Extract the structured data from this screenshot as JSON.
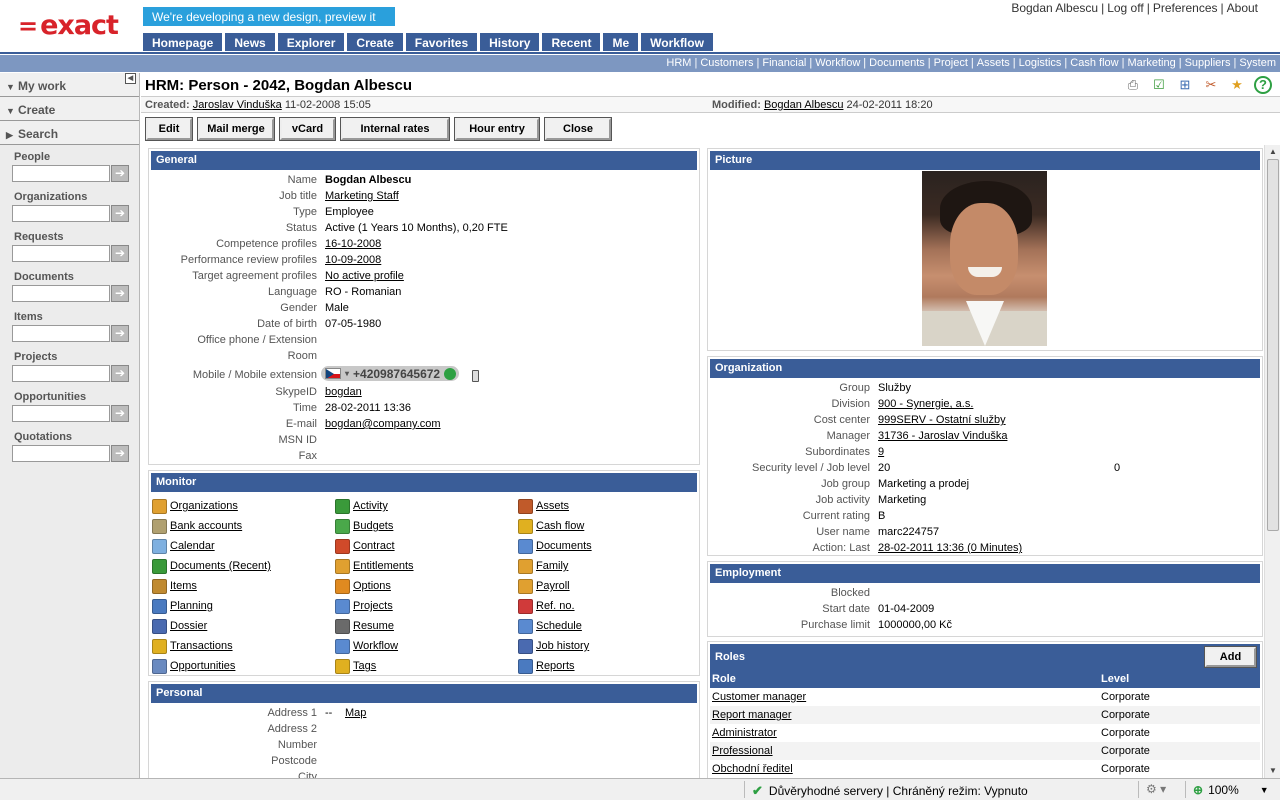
{
  "header": {
    "logo": "exact",
    "preview_banner": "We're developing a new design, preview it here!",
    "nav": [
      "Homepage",
      "News",
      "Explorer",
      "Create",
      "Favorites",
      "History",
      "Recent",
      "Me",
      "Workflow"
    ],
    "user_links": [
      "Bogdan Albescu",
      "Log off",
      "Preferences",
      "About"
    ]
  },
  "module_links": [
    "HRM",
    "Customers",
    "Financial",
    "Workflow",
    "Documents",
    "Project",
    "Assets",
    "Logistics",
    "Cash flow",
    "Marketing",
    "Suppliers",
    "System"
  ],
  "sidebar": {
    "heads": [
      "My work",
      "Create",
      "Search"
    ],
    "sections": [
      "People",
      "Organizations",
      "Requests",
      "Documents",
      "Items",
      "Projects",
      "Opportunities",
      "Quotations"
    ],
    "go_glyph": "➔"
  },
  "page": {
    "title": "HRM: Person - 2042, Bogdan Albescu",
    "created_label": "Created:",
    "created_by": "Jaroslav Vinduška",
    "created_at": "11-02-2008 15:05",
    "modified_label": "Modified:",
    "modified_by": "Bogdan Albescu",
    "modified_at": "24-02-2011 18:20"
  },
  "buttons": [
    "Edit",
    "Mail merge",
    "vCard",
    "Internal rates",
    "Hour entry",
    "Close"
  ],
  "toolbar_icons": [
    "print-icon",
    "checklist-icon",
    "add-window-icon",
    "tools-icon",
    "favorite-star-icon",
    "help-icon"
  ],
  "general": {
    "title": "General",
    "fields": [
      {
        "label": "Name",
        "value": "Bogdan Albescu",
        "bold": true
      },
      {
        "label": "Job title",
        "value": "Marketing Staff",
        "link": true
      },
      {
        "label": "Type",
        "value": "Employee"
      },
      {
        "label": "Status",
        "value": "Active (1 Years 10 Months), 0,20 FTE"
      },
      {
        "label": "Competence profiles",
        "value": "16-10-2008",
        "link": true
      },
      {
        "label": "Performance review profiles",
        "value": "10-09-2008",
        "link": true
      },
      {
        "label": "Target agreement profiles",
        "value": "No active profile",
        "link": true
      },
      {
        "label": "Language",
        "value": "RO - Romanian"
      },
      {
        "label": "Gender",
        "value": "Male"
      },
      {
        "label": "Date of birth",
        "value": "07-05-1980"
      },
      {
        "label": "Office phone / Extension",
        "value": ""
      },
      {
        "label": "Room",
        "value": ""
      }
    ],
    "mobile_label": "Mobile / Mobile extension",
    "mobile_number": "+420987645672",
    "fields2": [
      {
        "label": "SkypeID",
        "value": "bogdan",
        "link": true
      },
      {
        "label": "Time",
        "value": "28-02-2011 13:36"
      },
      {
        "label": "E-mail",
        "value": "bogdan@company.com",
        "link": true
      },
      {
        "label": "MSN ID",
        "value": ""
      },
      {
        "label": "Fax",
        "value": ""
      }
    ]
  },
  "monitor": {
    "title": "Monitor",
    "items": [
      {
        "label": "Organizations",
        "color": "#e0a030"
      },
      {
        "label": "Activity",
        "color": "#3a9a3a"
      },
      {
        "label": "Assets",
        "color": "#c05a2a"
      },
      {
        "label": "Bank accounts",
        "color": "#b0a070"
      },
      {
        "label": "Budgets",
        "color": "#4aa84a"
      },
      {
        "label": "Cash flow",
        "color": "#e0b020"
      },
      {
        "label": "Calendar",
        "color": "#7fb0e0"
      },
      {
        "label": "Contract",
        "color": "#d04a2a"
      },
      {
        "label": "Documents",
        "color": "#5a8ad0"
      },
      {
        "label": "Documents (Recent)",
        "color": "#3a9a3a"
      },
      {
        "label": "Entitlements",
        "color": "#e0a030"
      },
      {
        "label": "Family",
        "color": "#e0a030"
      },
      {
        "label": "Items",
        "color": "#c08a30"
      },
      {
        "label": "Options",
        "color": "#e08a20"
      },
      {
        "label": "Payroll",
        "color": "#e0a030"
      },
      {
        "label": "Planning",
        "color": "#4a7ac0"
      },
      {
        "label": "Projects",
        "color": "#5a8ad0"
      },
      {
        "label": "Ref. no.",
        "color": "#d03a3a"
      },
      {
        "label": "Dossier",
        "color": "#4a6ab0"
      },
      {
        "label": "Resume",
        "color": "#6a6a6a"
      },
      {
        "label": "Schedule",
        "color": "#5a8ad0"
      },
      {
        "label": "Transactions",
        "color": "#e0b020"
      },
      {
        "label": "Workflow",
        "color": "#5a8ad0"
      },
      {
        "label": "Job history",
        "color": "#4a6ab0"
      },
      {
        "label": "Opportunities",
        "color": "#6a8ac0"
      },
      {
        "label": "Tags",
        "color": "#e0b020"
      },
      {
        "label": "Reports",
        "color": "#4a7ac0"
      }
    ]
  },
  "personal": {
    "title": "Personal",
    "fields": [
      {
        "label": "Address 1",
        "value": "--",
        "extra": "Map"
      },
      {
        "label": "Address 2",
        "value": ""
      },
      {
        "label": "Number",
        "value": ""
      },
      {
        "label": "Postcode",
        "value": ""
      },
      {
        "label": "City",
        "value": ""
      }
    ]
  },
  "picture": {
    "title": "Picture"
  },
  "organization": {
    "title": "Organization",
    "fields": [
      {
        "label": "Group",
        "value": "Služby"
      },
      {
        "label": "Division",
        "value": "900 - Synergie, a.s.",
        "link": true
      },
      {
        "label": "Cost center",
        "value": "999SERV - Ostatní služby",
        "link": true
      },
      {
        "label": "Manager",
        "value": "31736 - Jaroslav Vinduška",
        "link": true
      },
      {
        "label": "Subordinates",
        "value": "9",
        "link": true
      },
      {
        "label": "Security level / Job level",
        "value": "20",
        "value2": "0"
      },
      {
        "label": "Job group",
        "value": "Marketing a prodej"
      },
      {
        "label": "Job activity",
        "value": "Marketing"
      },
      {
        "label": "Current rating",
        "value": "B"
      },
      {
        "label": "User name",
        "value": "marc224757"
      },
      {
        "label": "Action: Last",
        "value": "28-02-2011 13:36 (0 Minutes)",
        "link": true
      }
    ]
  },
  "employment": {
    "title": "Employment",
    "fields": [
      {
        "label": "Blocked",
        "value": ""
      },
      {
        "label": "Start date",
        "value": "01-04-2009"
      },
      {
        "label": "Purchase limit",
        "value": "1000000,00 Kč"
      }
    ]
  },
  "roles": {
    "title": "Roles",
    "add_label": "Add",
    "col_role": "Role",
    "col_level": "Level",
    "rows": [
      {
        "role": "Customer manager",
        "level": "Corporate"
      },
      {
        "role": "Report manager",
        "level": "Corporate"
      },
      {
        "role": "Administrator",
        "level": "Corporate"
      },
      {
        "role": "Professional",
        "level": "Corporate"
      },
      {
        "role": "Obchodní ředitel",
        "level": "Corporate"
      }
    ]
  },
  "statusbar": {
    "zone_text": "Důvěryhodné servery | Chráněný režim: Vypnuto",
    "zoom": "100%"
  }
}
